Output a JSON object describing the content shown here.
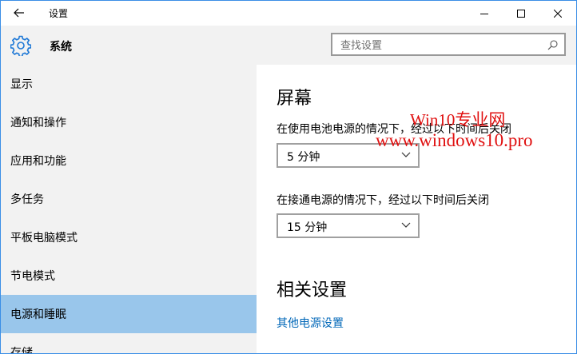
{
  "window": {
    "title": "设置",
    "controls": {
      "minimize": "minimize-icon",
      "maximize": "maximize-icon",
      "close": "close-icon"
    }
  },
  "header": {
    "title": "系统",
    "icon": "gear-icon",
    "search_placeholder": "查找设置"
  },
  "sidebar": {
    "items": [
      {
        "label": "显示",
        "active": false
      },
      {
        "label": "通知和操作",
        "active": false
      },
      {
        "label": "应用和功能",
        "active": false
      },
      {
        "label": "多任务",
        "active": false
      },
      {
        "label": "平板电脑模式",
        "active": false
      },
      {
        "label": "节电模式",
        "active": false
      },
      {
        "label": "电源和睡眠",
        "active": true
      },
      {
        "label": "存储",
        "active": false
      }
    ],
    "active_color": "#99c6eb"
  },
  "main": {
    "screen_title": "屏幕",
    "battery_label": "在使用电池电源的情况下，经过以下时间后关闭",
    "battery_value": "5 分钟",
    "plugged_label": "在接通电源的情况下，经过以下时间后关闭",
    "plugged_value": "15 分钟",
    "related_title": "相关设置",
    "related_link": "其他电源设置",
    "link_color": "#0067b8"
  },
  "watermark": {
    "line1": "Win10专业网",
    "line2": "www.windows10.pro",
    "color": "#e01010"
  }
}
